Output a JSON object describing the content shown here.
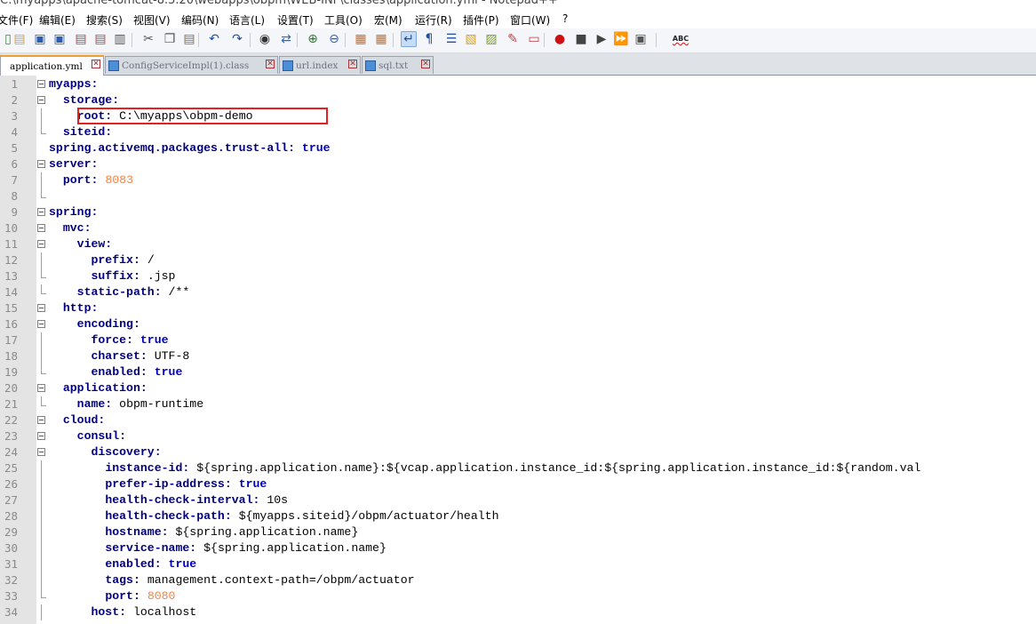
{
  "window": {
    "title": "C:\\myapps\\apache-tomcat-8.5.20\\webapps\\obpm\\WEB-INF\\classes\\application.yml - Notepad++"
  },
  "menu": [
    "文件(F)",
    "编辑(E)",
    "搜索(S)",
    "视图(V)",
    "编码(N)",
    "语言(L)",
    "设置(T)",
    "工具(O)",
    "宏(M)",
    "运行(R)",
    "插件(P)",
    "窗口(W)",
    "?"
  ],
  "toolbar": {
    "icons": [
      "new-file-icon",
      "open-file-icon",
      "save-icon",
      "save-all-icon",
      "close-icon",
      "close-all-icon",
      "print-icon",
      "cut-icon",
      "copy-icon",
      "paste-icon",
      "undo-icon",
      "redo-icon",
      "find-icon",
      "replace-icon",
      "zoom-in-icon",
      "zoom-out-icon",
      "sync-vertical-icon",
      "sync-horizontal-icon",
      "word-wrap-icon",
      "show-all-chars-icon",
      "indent-guide-icon",
      "document-map-icon",
      "function-list-icon",
      "folder-workspace-icon",
      "monitoring-icon",
      "record-macro-icon",
      "stop-record-icon",
      "play-macro-icon",
      "run-macro-multiple-icon",
      "save-macro-icon",
      "spell-check-icon"
    ],
    "spellcheck_label": "ABC"
  },
  "tabs": [
    {
      "label": "application.yml",
      "active": true
    },
    {
      "label": "ConfigServiceImpl(1).class",
      "active": false
    },
    {
      "label": "url.index",
      "active": false
    },
    {
      "label": "sql.txt",
      "active": false
    }
  ],
  "editor": {
    "lines": [
      {
        "n": "1",
        "fold": "box",
        "indent": "",
        "key": "myapps",
        "value": "",
        "vtype": ""
      },
      {
        "n": "2",
        "fold": "box",
        "indent": "  ",
        "key": "storage",
        "value": "",
        "vtype": ""
      },
      {
        "n": "3",
        "fold": "line",
        "indent": "    ",
        "key": "root",
        "value": "C:\\myapps\\obpm-demo",
        "vtype": "str"
      },
      {
        "n": "4",
        "fold": "corner",
        "indent": "  ",
        "key": "siteid",
        "value": "",
        "vtype": ""
      },
      {
        "n": "5",
        "fold": "",
        "indent": "",
        "key": "spring.activemq.packages.trust-all",
        "value": "true",
        "vtype": "bool"
      },
      {
        "n": "6",
        "fold": "box",
        "indent": "",
        "key": "server",
        "value": "",
        "vtype": ""
      },
      {
        "n": "7",
        "fold": "line",
        "indent": "  ",
        "key": "port",
        "value": "8083",
        "vtype": "num"
      },
      {
        "n": "8",
        "fold": "corner",
        "indent": "",
        "key": "",
        "value": "",
        "vtype": ""
      },
      {
        "n": "9",
        "fold": "box",
        "indent": "",
        "key": "spring",
        "value": "",
        "vtype": ""
      },
      {
        "n": "10",
        "fold": "box",
        "indent": "  ",
        "key": "mvc",
        "value": "",
        "vtype": ""
      },
      {
        "n": "11",
        "fold": "box",
        "indent": "    ",
        "key": "view",
        "value": "",
        "vtype": ""
      },
      {
        "n": "12",
        "fold": "line",
        "indent": "      ",
        "key": "prefix",
        "value": "/",
        "vtype": "str"
      },
      {
        "n": "13",
        "fold": "corner",
        "indent": "      ",
        "key": "suffix",
        "value": ".jsp",
        "vtype": "str"
      },
      {
        "n": "14",
        "fold": "corner",
        "indent": "    ",
        "key": "static-path",
        "value": "/**",
        "vtype": "str"
      },
      {
        "n": "15",
        "fold": "box",
        "indent": "  ",
        "key": "http",
        "value": "",
        "vtype": ""
      },
      {
        "n": "16",
        "fold": "box",
        "indent": "    ",
        "key": "encoding",
        "value": "",
        "vtype": ""
      },
      {
        "n": "17",
        "fold": "line",
        "indent": "      ",
        "key": "force",
        "value": "true",
        "vtype": "bool"
      },
      {
        "n": "18",
        "fold": "line",
        "indent": "      ",
        "key": "charset",
        "value": "UTF-8",
        "vtype": "str"
      },
      {
        "n": "19",
        "fold": "corner",
        "indent": "      ",
        "key": "enabled",
        "value": "true",
        "vtype": "bool"
      },
      {
        "n": "20",
        "fold": "box",
        "indent": "  ",
        "key": "application",
        "value": "",
        "vtype": ""
      },
      {
        "n": "21",
        "fold": "corner",
        "indent": "    ",
        "key": "name",
        "value": "obpm-runtime",
        "vtype": "str"
      },
      {
        "n": "22",
        "fold": "box",
        "indent": "  ",
        "key": "cloud",
        "value": "",
        "vtype": ""
      },
      {
        "n": "23",
        "fold": "box",
        "indent": "    ",
        "key": "consul",
        "value": "",
        "vtype": ""
      },
      {
        "n": "24",
        "fold": "box",
        "indent": "      ",
        "key": "discovery",
        "value": "",
        "vtype": ""
      },
      {
        "n": "25",
        "fold": "line",
        "indent": "        ",
        "key": "instance-id",
        "value": "${spring.application.name}:${vcap.application.instance_id:${spring.application.instance_id:${random.val",
        "vtype": "str"
      },
      {
        "n": "26",
        "fold": "line",
        "indent": "        ",
        "key": "prefer-ip-address",
        "value": "true",
        "vtype": "bool"
      },
      {
        "n": "27",
        "fold": "line",
        "indent": "        ",
        "key": "health-check-interval",
        "value": "10s",
        "vtype": "str"
      },
      {
        "n": "28",
        "fold": "line",
        "indent": "        ",
        "key": "health-check-path",
        "value": "${myapps.siteid}/obpm/actuator/health",
        "vtype": "str"
      },
      {
        "n": "29",
        "fold": "line",
        "indent": "        ",
        "key": "hostname",
        "value": "${spring.application.name}",
        "vtype": "str"
      },
      {
        "n": "30",
        "fold": "line",
        "indent": "        ",
        "key": "service-name",
        "value": "${spring.application.name}",
        "vtype": "str"
      },
      {
        "n": "31",
        "fold": "line",
        "indent": "        ",
        "key": "enabled",
        "value": "true",
        "vtype": "bool"
      },
      {
        "n": "32",
        "fold": "line",
        "indent": "        ",
        "key": "tags",
        "value": "management.context-path=/obpm/actuator",
        "vtype": "str"
      },
      {
        "n": "33",
        "fold": "corner",
        "indent": "        ",
        "key": "port",
        "value": "8080",
        "vtype": "num"
      },
      {
        "n": "34",
        "fold": "line",
        "indent": "      ",
        "key": "host",
        "value": "localhost",
        "vtype": "str"
      }
    ]
  },
  "colors": {
    "key": "#000080",
    "number": "#ff8040",
    "boolean": "#0000c0",
    "highlight_box": "#e62020",
    "active_tab_accent": "#f0a030"
  }
}
